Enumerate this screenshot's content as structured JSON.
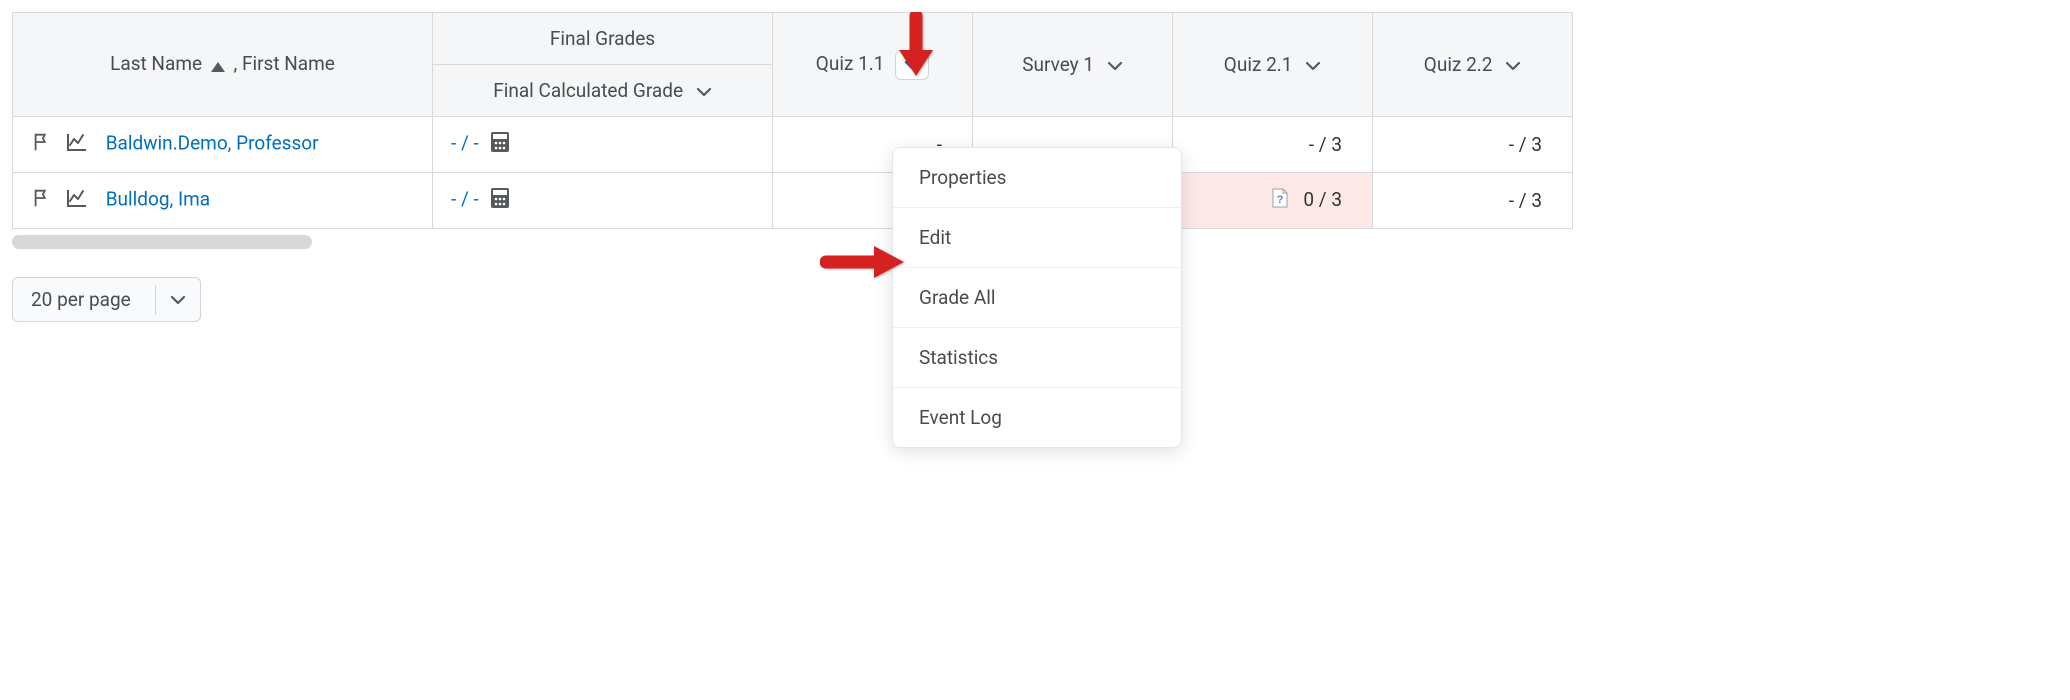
{
  "headers": {
    "name_label_last": "Last Name",
    "name_label_first": ", First Name",
    "final_group": "Final Grades",
    "final_calc": "Final Calculated Grade",
    "quiz11": "Quiz 1.1",
    "survey1": "Survey 1",
    "quiz21": "Quiz 2.1",
    "quiz22": "Quiz 2.2"
  },
  "rows": [
    {
      "name": "Baldwin.Demo, Professor",
      "final": "- / -",
      "quiz11": "-",
      "survey1": "",
      "quiz21": "- / 3",
      "quiz22": "- / 3",
      "quiz21_draft": false,
      "quiz21_pink": false
    },
    {
      "name": "Bulldog, Ima",
      "final": "- / -",
      "quiz11": "-",
      "survey1": "",
      "quiz21": "0 / 3",
      "quiz22": "- / 3",
      "quiz21_draft": true,
      "quiz21_pink": true
    }
  ],
  "dropdown": {
    "items": [
      "Properties",
      "Edit",
      "Grade All",
      "Statistics",
      "Event Log"
    ]
  },
  "pager": {
    "label": "20 per page"
  },
  "colors": {
    "link": "#006fbf",
    "chev_active": "#006fbf",
    "chev_idle": "#565a5c",
    "pink": "#fde8e8",
    "arrow": "#d62f2f"
  }
}
